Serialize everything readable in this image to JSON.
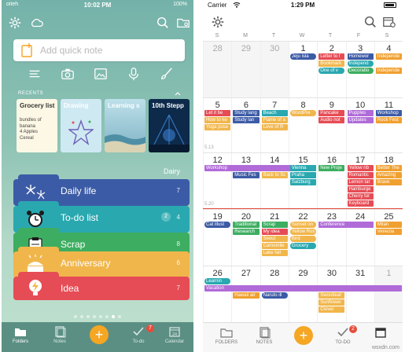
{
  "left": {
    "status": {
      "carrier": "oiteh",
      "time": "10:02 PM",
      "battery": "100%"
    },
    "quick_note_placeholder": "Add quick note",
    "recents_label": "RECENTS",
    "recent_cards": [
      {
        "title": "Grocery list",
        "body": "bundles of banana\n4 Apples\nCereal",
        "bg": "#fdf8e6"
      },
      {
        "title": "Drawing",
        "body": "",
        "bg": "#cfe9f3"
      },
      {
        "title": "Learning s",
        "body": "",
        "bg": "#bde0ea"
      },
      {
        "title": "10th Stepp",
        "body": "",
        "bg": "#0d2a4b"
      }
    ],
    "section_label": "Dairy",
    "folders": [
      {
        "name": "Daily life",
        "count": "7",
        "color": "#3c5ba6",
        "icon": "fireworks-icon"
      },
      {
        "name": "To-do list",
        "count": "4",
        "badge": "2",
        "color": "#2aa8b0",
        "icon": "alarm-clock-icon"
      },
      {
        "name": "Scrap",
        "count": "8",
        "color": "#3dae61",
        "icon": "clipboard-icon"
      },
      {
        "name": "Anniversary",
        "count": "6",
        "color": "#f1b64b",
        "icon": "cake-icon"
      },
      {
        "name": "Idea",
        "count": "7",
        "color": "#e64c55",
        "icon": "lightbulb-icon"
      }
    ],
    "tabs": [
      {
        "label": "Folders",
        "icon": "folders-icon"
      },
      {
        "label": "Notes",
        "icon": "notes-icon"
      },
      {
        "label": "To-do",
        "icon": "check-icon",
        "badge": "7"
      },
      {
        "label": "Calendar",
        "icon": "calendar-icon",
        "day": "24"
      }
    ]
  },
  "right": {
    "status": {
      "carrier": "Carrier",
      "time": "1:29 PM"
    },
    "weekdays": [
      "S",
      "M",
      "T",
      "W",
      "T",
      "F",
      "S"
    ],
    "weeks": [
      {
        "label": "",
        "days": [
          "28",
          "29",
          "30",
          "1",
          "2",
          "3",
          "4"
        ],
        "muted": [
          0,
          1,
          2
        ]
      },
      {
        "label": "5.13",
        "days": [
          "5",
          "6",
          "7",
          "8",
          "9",
          "10",
          "11"
        ],
        "muted": []
      },
      {
        "label": "5.20",
        "days": [
          "12",
          "13",
          "14",
          "15",
          "16",
          "17",
          "18"
        ],
        "muted": []
      },
      {
        "label": "",
        "days": [
          "19",
          "20",
          "21",
          "22",
          "23",
          "24",
          "25"
        ],
        "muted": []
      },
      {
        "label": "",
        "days": [
          "26",
          "27",
          "28",
          "29",
          "30",
          "31",
          "1"
        ],
        "muted": [
          6
        ]
      }
    ],
    "events": [
      {
        "w": 0,
        "c": 3,
        "r": 0,
        "text": "Jeju isla",
        "color": "#3c5ba6",
        "pill": true
      },
      {
        "w": 0,
        "c": 4,
        "r": 0,
        "text": "Letter to f",
        "color": "#e64c55"
      },
      {
        "w": 0,
        "c": 4,
        "r": 1,
        "text": "Bookmark",
        "color": "#f1b64b"
      },
      {
        "w": 0,
        "c": 4,
        "r": 2,
        "text": "One of v",
        "color": "#2aa8b0",
        "pill": true
      },
      {
        "w": 0,
        "c": 5,
        "r": 0,
        "text": "Homewor",
        "color": "#3c5ba6"
      },
      {
        "w": 0,
        "c": 5,
        "r": 1,
        "text": "Independ",
        "color": "#2aa8b0",
        "pill": true
      },
      {
        "w": 0,
        "c": 5,
        "r": 2,
        "text": "Decoratio",
        "color": "#3dae61",
        "pill": true
      },
      {
        "w": 0,
        "c": 6,
        "r": 0,
        "text": "Independe",
        "color": "#f0a030"
      },
      {
        "w": 0,
        "c": 6,
        "r": 2,
        "text": "Independe",
        "color": "#f0a030"
      },
      {
        "w": 1,
        "c": 0,
        "r": 0,
        "text": "Let it be",
        "color": "#e64c55"
      },
      {
        "w": 1,
        "c": 0,
        "r": 1,
        "text": "How to ke",
        "color": "#f1b64b"
      },
      {
        "w": 1,
        "c": 0,
        "r": 2,
        "text": "Yoga pose",
        "color": "#f1b64b"
      },
      {
        "w": 1,
        "c": 1,
        "r": 0,
        "text": "Study lang",
        "color": "#3c5ba6"
      },
      {
        "w": 1,
        "c": 1,
        "r": 1,
        "text": "Study lan",
        "color": "#3c5ba6"
      },
      {
        "w": 1,
        "c": 2,
        "r": 0,
        "text": "Beach",
        "color": "#2aa8b0"
      },
      {
        "w": 1,
        "c": 2,
        "r": 1,
        "text": "Flame of a",
        "color": "#f1b64b"
      },
      {
        "w": 1,
        "c": 2,
        "r": 2,
        "text": "Love of R",
        "color": "#f1b64b"
      },
      {
        "w": 1,
        "c": 3,
        "r": 0,
        "text": "WordPre",
        "color": "#f1b64b",
        "pill": true
      },
      {
        "w": 1,
        "c": 4,
        "r": 0,
        "text": "Pancake",
        "color": "#e64c55"
      },
      {
        "w": 1,
        "c": 4,
        "r": 1,
        "text": "Audio not",
        "color": "#e64c55"
      },
      {
        "w": 1,
        "c": 5,
        "r": 0,
        "text": "Pupples",
        "color": "#b06bd8"
      },
      {
        "w": 1,
        "c": 5,
        "r": 1,
        "text": "Updates",
        "color": "#b06bd8"
      },
      {
        "w": 1,
        "c": 6,
        "r": 0,
        "text": "Workshop",
        "color": "#3c5ba6"
      },
      {
        "w": 1,
        "c": 6,
        "r": 1,
        "text": "Rock Fest",
        "color": "#f0a030"
      },
      {
        "w": 2,
        "c": 0,
        "r": 0,
        "span": 4,
        "text": "Workshop",
        "color": "#b06bd8"
      },
      {
        "w": 2,
        "c": 1,
        "r": 1,
        "text": "Music Fes",
        "color": "#3c5ba6"
      },
      {
        "w": 2,
        "c": 2,
        "r": 1,
        "text": "Back to Sc",
        "color": "#f1b64b"
      },
      {
        "w": 2,
        "c": 3,
        "r": 0,
        "text": "Vienna",
        "color": "#2aa8b0"
      },
      {
        "w": 2,
        "c": 3,
        "r": 1,
        "text": "Praha",
        "color": "#2aa8b0"
      },
      {
        "w": 2,
        "c": 3,
        "r": 2,
        "text": "Salzburg",
        "color": "#2aa8b0"
      },
      {
        "w": 2,
        "c": 4,
        "r": 0,
        "text": "New Proje",
        "color": "#3dae61"
      },
      {
        "w": 2,
        "c": 5,
        "r": 0,
        "text": "Yellow rib",
        "color": "#e64c55"
      },
      {
        "w": 2,
        "c": 5,
        "r": 1,
        "text": "Romantic",
        "color": "#e64c55"
      },
      {
        "w": 2,
        "c": 5,
        "r": 2,
        "text": "Lemon tar",
        "color": "#e64c55"
      },
      {
        "w": 2,
        "c": 5,
        "r": 3,
        "text": "Hamburge",
        "color": "#e64c55"
      },
      {
        "w": 2,
        "c": 5,
        "r": 4,
        "text": "Cherry tor",
        "color": "#e64c55"
      },
      {
        "w": 2,
        "c": 5,
        "r": 5,
        "text": "Keyboard",
        "color": "#e64c55"
      },
      {
        "w": 2,
        "c": 6,
        "r": 0,
        "text": "Better The",
        "color": "#f0a030"
      },
      {
        "w": 2,
        "c": 6,
        "r": 1,
        "text": "Amazing",
        "color": "#f0a030"
      },
      {
        "w": 2,
        "c": 6,
        "r": 2,
        "text": "Brave",
        "color": "#f0a030"
      },
      {
        "w": 3,
        "c": 0,
        "r": 0,
        "text": "Cat illust",
        "color": "#3c5ba6",
        "pill": true
      },
      {
        "w": 3,
        "c": 1,
        "r": 0,
        "text": "Traditional",
        "color": "#3dae61"
      },
      {
        "w": 3,
        "c": 1,
        "r": 1,
        "text": "Research",
        "color": "#3dae61"
      },
      {
        "w": 3,
        "c": 2,
        "r": 0,
        "text": "Scrap",
        "color": "#3dae61"
      },
      {
        "w": 3,
        "c": 2,
        "r": 1,
        "text": "My idea",
        "color": "#e64c55"
      },
      {
        "w": 3,
        "c": 2,
        "r": 2,
        "text": "Seoul",
        "color": "#f1b64b"
      },
      {
        "w": 3,
        "c": 2,
        "r": 3,
        "text": "Camomile",
        "color": "#f1b64b"
      },
      {
        "w": 3,
        "c": 2,
        "r": 4,
        "text": "Lake fall",
        "color": "#f1b64b"
      },
      {
        "w": 3,
        "c": 3,
        "r": 0,
        "text": "Sunset on",
        "color": "#f1b64b",
        "pill": true
      },
      {
        "w": 3,
        "c": 3,
        "r": 1,
        "text": "Yellow Ros",
        "color": "#f1b64b",
        "pill": true
      },
      {
        "w": 3,
        "c": 3,
        "r": 2,
        "text": "Bird",
        "color": "#f1b64b",
        "pill": true
      },
      {
        "w": 3,
        "c": 3,
        "r": 3,
        "text": "Grocery",
        "color": "#2aa8b0",
        "pill": true
      },
      {
        "w": 3,
        "c": 4,
        "r": 0,
        "span": 2,
        "text": "Conference",
        "color": "#b06bd8"
      },
      {
        "w": 3,
        "c": 6,
        "r": 0,
        "text": "Milan",
        "color": "#f0a030"
      },
      {
        "w": 3,
        "c": 6,
        "r": 1,
        "text": "Venezia",
        "color": "#f0a030"
      },
      {
        "w": 4,
        "c": 0,
        "r": 0,
        "text": "Learnin",
        "color": "#2aa8b0",
        "pill": true
      },
      {
        "w": 4,
        "c": 0,
        "r": 1,
        "span": 7,
        "text": "Vacation",
        "color": "#b06bd8"
      },
      {
        "w": 4,
        "c": 1,
        "r": 2,
        "text": "Hawaii air",
        "color": "#f0a030"
      },
      {
        "w": 4,
        "c": 2,
        "r": 2,
        "text": "Naruto ill",
        "color": "#3c5ba6",
        "pill": true
      },
      {
        "w": 4,
        "c": 4,
        "r": 2,
        "text": "Swordleaf",
        "color": "#f1b64b"
      },
      {
        "w": 4,
        "c": 4,
        "r": 3,
        "text": "Sunflower",
        "color": "#f1b64b"
      },
      {
        "w": 4,
        "c": 4,
        "r": 4,
        "text": "Clover",
        "color": "#f1b64b"
      }
    ],
    "tabs": [
      {
        "label": "FOLDERS",
        "icon": "folders-icon"
      },
      {
        "label": "NOTES",
        "icon": "notes-icon"
      },
      {
        "label": "TO-DO",
        "icon": "check-icon",
        "badge": "2"
      },
      {
        "label": "",
        "icon": "calendar-icon"
      }
    ],
    "watermark": "wsxdn.com"
  },
  "colors": {
    "accent": "#f5a623",
    "today": "#e74c3c"
  }
}
